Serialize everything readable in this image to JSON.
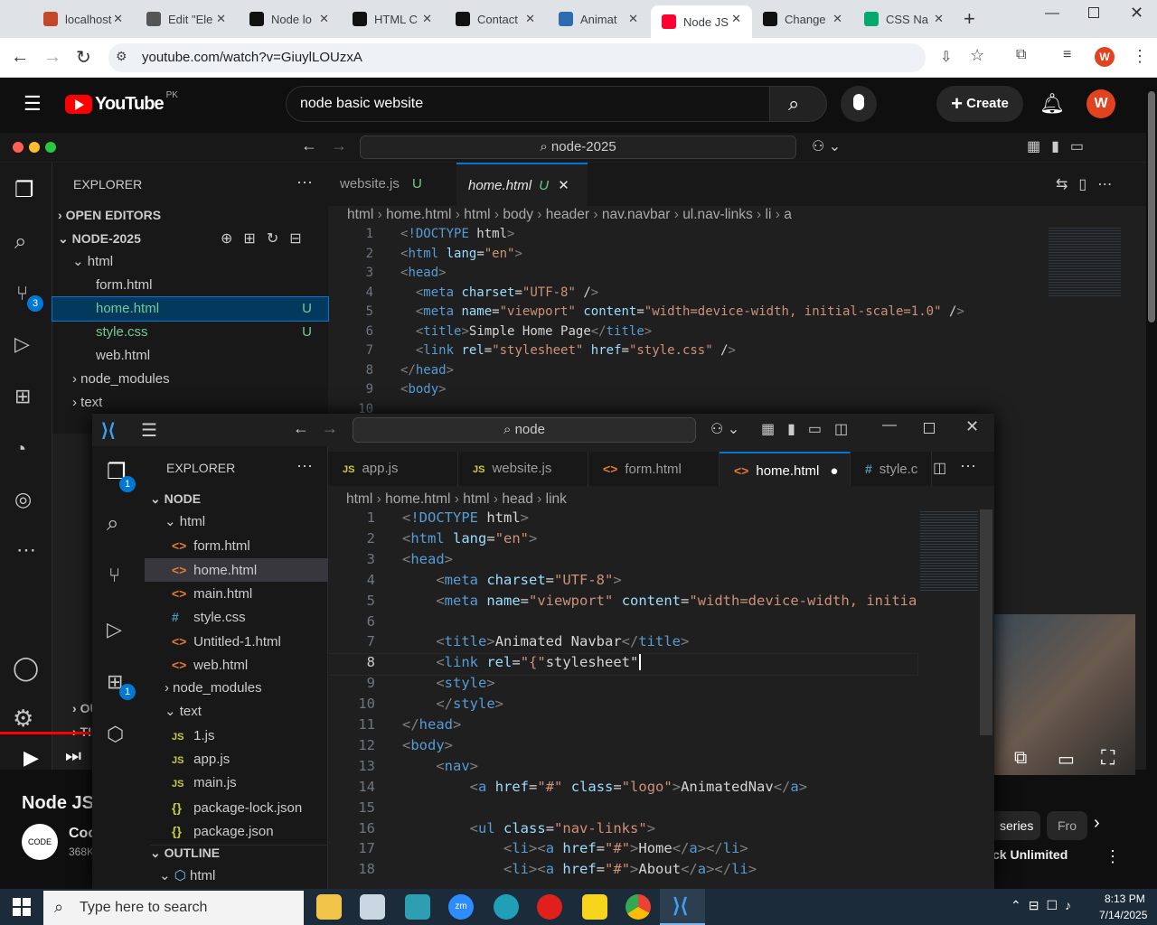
{
  "browser": {
    "tabs": [
      {
        "title": "localhost",
        "icon": "localhost-favicon",
        "color": "#c4472a"
      },
      {
        "title": "Edit \"Ele",
        "icon": "globe-icon",
        "color": "#555555"
      },
      {
        "title": "Node lo",
        "icon": "github-icon",
        "color": "#111111"
      },
      {
        "title": "HTML C",
        "icon": "github-icon",
        "color": "#111111"
      },
      {
        "title": "Contact",
        "icon": "github-icon",
        "color": "#111111"
      },
      {
        "title": "Animat",
        "icon": "animate-icon",
        "color": "#2b6cb0"
      },
      {
        "title": "Node JS",
        "icon": "youtube-icon",
        "color": "#ff0033"
      },
      {
        "title": "Change",
        "icon": "github-icon",
        "color": "#111111"
      },
      {
        "title": "CSS Na",
        "icon": "w3-icon",
        "color": "#04aa6d"
      }
    ],
    "url": "youtube.com/watch?v=GiuylLOUzxA",
    "profile_letter": "W"
  },
  "youtube": {
    "logo": "YouTube",
    "region": "PK",
    "search_query": "node basic website",
    "create_label": "Create",
    "avatar_letter": "W",
    "video_title": "Node JS",
    "channel_abbrev": "Coo",
    "subscribers": "368K",
    "series_chip": "series",
    "from_chip": "Fro",
    "unlimited_text": "ck Unlimited"
  },
  "vscode_back": {
    "command_center": "node-2025",
    "explorer_title": "EXPLORER",
    "open_editors": "OPEN EDITORS",
    "project": "NODE-2025",
    "tree": [
      {
        "label": "html",
        "depth": 1,
        "kind": "folder-open"
      },
      {
        "label": "form.html",
        "depth": 2,
        "kind": "file",
        "badge": ""
      },
      {
        "label": "home.html",
        "depth": 2,
        "kind": "file",
        "badge": "U"
      },
      {
        "label": "style.css",
        "depth": 2,
        "kind": "file",
        "badge": "U"
      },
      {
        "label": "web.html",
        "depth": 2,
        "kind": "file",
        "badge": ""
      },
      {
        "label": "node_modules",
        "depth": 1,
        "kind": "folder"
      },
      {
        "label": "text",
        "depth": 1,
        "kind": "folder"
      }
    ],
    "tabs": [
      {
        "label": "website.js",
        "badge": "U"
      },
      {
        "label": "home.html",
        "badge": "U"
      }
    ],
    "breadcrumb": [
      "html",
      "home.html",
      "html",
      "body",
      "header",
      "nav.navbar",
      "ul.nav-links",
      "li",
      "a"
    ],
    "scm_count": "3",
    "code": [
      {
        "n": "1",
        "text": "<!DOCTYPE html>"
      },
      {
        "n": "2",
        "text": "<html lang=\"en\">"
      },
      {
        "n": "3",
        "text": "<head>"
      },
      {
        "n": "4",
        "text": "  <meta charset=\"UTF-8\" />"
      },
      {
        "n": "5",
        "text": "  <meta name=\"viewport\" content=\"width=device-width, initial-scale=1.0\" />"
      },
      {
        "n": "6",
        "text": "  <title>Simple Home Page</title>"
      },
      {
        "n": "7",
        "text": "  <link rel=\"stylesheet\" href=\"style.css\" />"
      },
      {
        "n": "8",
        "text": "</head>"
      },
      {
        "n": "9",
        "text": "<body>"
      },
      {
        "n": "10",
        "text": ""
      }
    ],
    "partial_outline": [
      "OU",
      "TIM"
    ]
  },
  "vscode_front": {
    "command_center": "node",
    "explorer_title": "EXPLORER",
    "project": "NODE",
    "explorer_badge": "1",
    "extensions_badge": "1",
    "tree": [
      {
        "label": "html",
        "kind": "folder-open",
        "icon": "",
        "indent": 1
      },
      {
        "label": "form.html",
        "kind": "file",
        "icon": "<>",
        "indent": 2
      },
      {
        "label": "home.html",
        "kind": "file",
        "icon": "<>",
        "indent": 2,
        "selected": true
      },
      {
        "label": "main.html",
        "kind": "file",
        "icon": "<>",
        "indent": 2
      },
      {
        "label": "style.css",
        "kind": "file",
        "icon": "#",
        "indent": 2
      },
      {
        "label": "Untitled-1.html",
        "kind": "file",
        "icon": "<>",
        "indent": 2
      },
      {
        "label": "web.html",
        "kind": "file",
        "icon": "<>",
        "indent": 2
      },
      {
        "label": "node_modules",
        "kind": "folder",
        "icon": "",
        "indent": 1
      },
      {
        "label": "text",
        "kind": "folder-open",
        "icon": "",
        "indent": 1
      },
      {
        "label": "1.js",
        "kind": "file",
        "icon": "JS",
        "indent": 2
      },
      {
        "label": "app.js",
        "kind": "file",
        "icon": "JS",
        "indent": 2
      },
      {
        "label": "main.js",
        "kind": "file",
        "icon": "JS",
        "indent": 2
      },
      {
        "label": "package-lock.json",
        "kind": "file",
        "icon": "{}",
        "indent": 2
      },
      {
        "label": "package.json",
        "kind": "file",
        "icon": "{}",
        "indent": 2
      }
    ],
    "outline_title": "OUTLINE",
    "outline_item": "html",
    "tabs": [
      {
        "label": "app.js",
        "icon": "JS"
      },
      {
        "label": "website.js",
        "icon": "JS"
      },
      {
        "label": "form.html",
        "icon": "<>"
      },
      {
        "label": "home.html",
        "icon": "<>"
      },
      {
        "label": "style.c",
        "icon": "#"
      }
    ],
    "breadcrumb": [
      "html",
      "home.html",
      "html",
      "head",
      "link"
    ],
    "code": [
      {
        "n": "1",
        "text": "<!DOCTYPE html>"
      },
      {
        "n": "2",
        "text": "<html lang=\"en\">"
      },
      {
        "n": "3",
        "text": "<head>"
      },
      {
        "n": "4",
        "text": "    <meta charset=\"UTF-8\">"
      },
      {
        "n": "5",
        "text": "    <meta name=\"viewport\" content=\"width=device-width, initial-scale=1.0\">"
      },
      {
        "n": "6",
        "text": ""
      },
      {
        "n": "7",
        "text": "    <title>Animated Navbar</title>"
      },
      {
        "n": "8",
        "text": "    <link rel=\"{\"stylesheet\""
      },
      {
        "n": "9",
        "text": "    <style>"
      },
      {
        "n": "10",
        "text": "    </style>"
      },
      {
        "n": "11",
        "text": "</head>"
      },
      {
        "n": "12",
        "text": "<body>"
      },
      {
        "n": "13",
        "text": "    <nav>"
      },
      {
        "n": "14",
        "text": "        <a href=\"#\" class=\"logo\">AnimatedNav</a>"
      },
      {
        "n": "15",
        "text": ""
      },
      {
        "n": "16",
        "text": "        <ul class=\"nav-links\">"
      },
      {
        "n": "17",
        "text": "            <li><a href=\"#\">Home</a></li>"
      },
      {
        "n": "18",
        "text": "            <li><a href=\"#\">About</a></li>"
      }
    ]
  },
  "taskbar": {
    "search_placeholder": "Type here to search",
    "time": "8:13 PM",
    "date": "7/14/2025"
  }
}
